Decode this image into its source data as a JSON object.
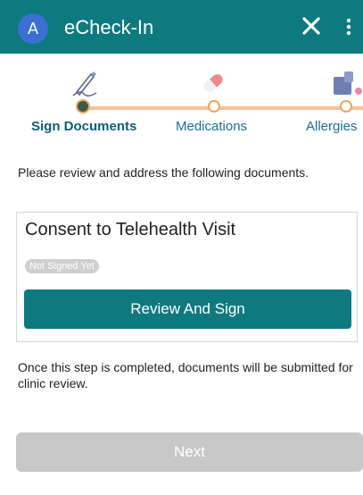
{
  "header": {
    "avatar_initial": "A",
    "title": "eCheck-In",
    "close_icon": "close-icon",
    "menu_icon": "more-vertical-icon",
    "background": "#0d7a80"
  },
  "steps": [
    {
      "label": "Sign Documents",
      "icon": "pen-icon",
      "active": true
    },
    {
      "label": "Medications",
      "icon": "pill-icon",
      "active": false
    },
    {
      "label": "Allergies",
      "icon": "allergy-icon",
      "active": false
    }
  ],
  "instruction": "Please review and address the following documents.",
  "document": {
    "title": "Consent to Telehealth Visit",
    "status": "Not Signed Yet",
    "action_label": "Review And Sign"
  },
  "footer_note": "Once this step is completed, documents will be submitted for clinic review.",
  "next_label": "Next",
  "colors": {
    "accent": "#0d7a80",
    "step_line": "#f2c49b",
    "disabled": "#c7c7c7"
  }
}
